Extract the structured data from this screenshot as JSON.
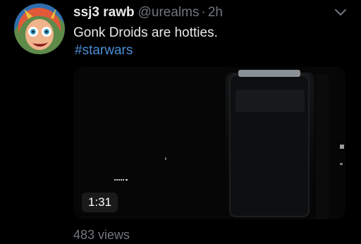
{
  "tweet": {
    "display_name": "ssj3 rawb",
    "handle": "@urealms",
    "separator": "·",
    "time": "2h",
    "text": "Gonk Droids are hotties.",
    "hashtag": "#starwars",
    "avatar": "cartoon-face-avatar",
    "menu_icon": "chevron-down-icon"
  },
  "video": {
    "duration": "1:31",
    "views": "483 views"
  },
  "colors": {
    "background": "#000000",
    "text": "#e7e9ea",
    "secondary": "#71767b",
    "link": "#4a8fd8"
  }
}
